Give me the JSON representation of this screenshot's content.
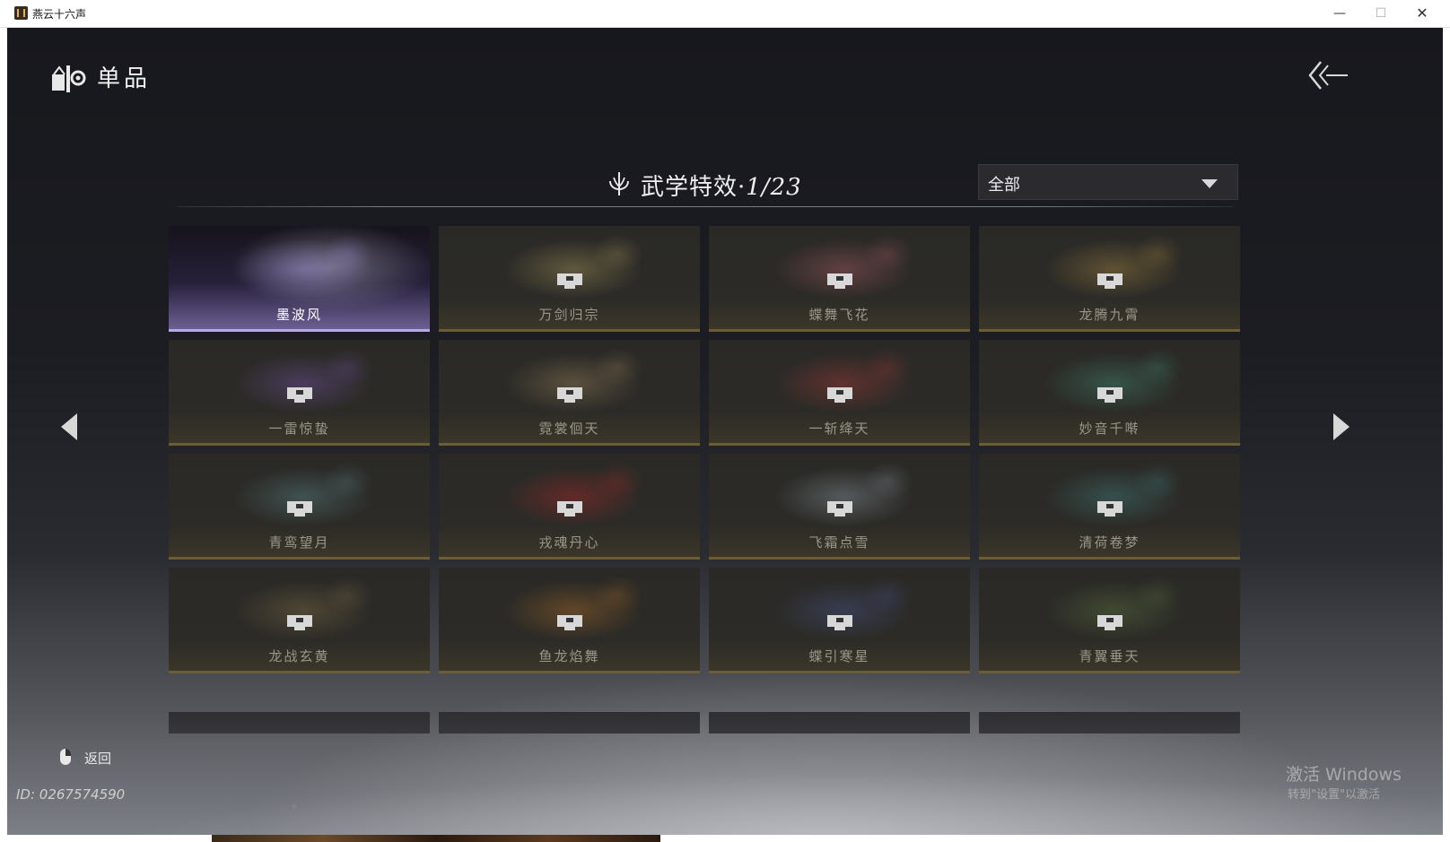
{
  "window": {
    "title": "燕云十六声"
  },
  "header": {
    "title": "单品"
  },
  "section": {
    "title": "武学特效·",
    "count": "1/23"
  },
  "filter": {
    "selected": "全部"
  },
  "cards": [
    {
      "name": "墨波风",
      "selected": true,
      "locked": false,
      "color": "#b9a8ff"
    },
    {
      "name": "万剑归宗",
      "selected": false,
      "locked": true,
      "color": "#c9b46a"
    },
    {
      "name": "蝶舞飞花",
      "selected": false,
      "locked": true,
      "color": "#d06a7a"
    },
    {
      "name": "龙腾九霄",
      "selected": false,
      "locked": true,
      "color": "#c9a04a"
    },
    {
      "name": "一雷惊蛰",
      "selected": false,
      "locked": true,
      "color": "#8a5fc8"
    },
    {
      "name": "霓裳佪天",
      "selected": false,
      "locked": true,
      "color": "#b89a6a"
    },
    {
      "name": "一斩绛天",
      "selected": false,
      "locked": true,
      "color": "#c84040"
    },
    {
      "name": "妙音千啭",
      "selected": false,
      "locked": true,
      "color": "#4aa88a"
    },
    {
      "name": "青鸾望月",
      "selected": false,
      "locked": true,
      "color": "#6aa0a8"
    },
    {
      "name": "戎魂丹心",
      "selected": false,
      "locked": true,
      "color": "#d02a2a"
    },
    {
      "name": "飞霜点雪",
      "selected": false,
      "locked": true,
      "color": "#a8b8c8"
    },
    {
      "name": "清荷卷梦",
      "selected": false,
      "locked": true,
      "color": "#4a9a9a"
    },
    {
      "name": "龙战玄黄",
      "selected": false,
      "locked": true,
      "color": "#9a8050"
    },
    {
      "name": "鱼龙焰舞",
      "selected": false,
      "locked": true,
      "color": "#d0802a"
    },
    {
      "name": "蝶引寒星",
      "selected": false,
      "locked": true,
      "color": "#5060a8"
    },
    {
      "name": "青翼垂天",
      "selected": false,
      "locked": true,
      "color": "#6a8a4a"
    }
  ],
  "footer": {
    "back_label": "返回",
    "player_id": "ID: 0267574590"
  },
  "watermark": {
    "line1": "激活 Windows",
    "line2": "转到\"设置\"以激活"
  }
}
